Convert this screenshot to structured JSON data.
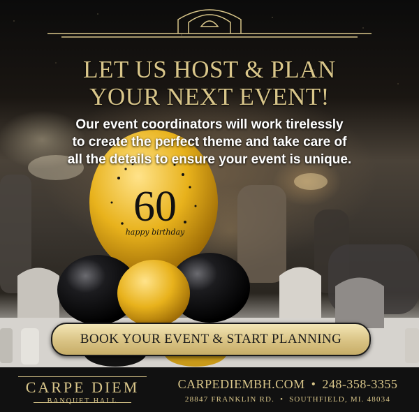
{
  "headline": {
    "line1": "LET US HOST & PLAN",
    "line2": "YOUR NEXT EVENT!"
  },
  "subheadline": {
    "line1": "Our event coordinators will work tirelessly",
    "line2": "to create the perfect theme and take care of",
    "line3": "all the details to ensure your event is unique."
  },
  "balloon": {
    "number": "60",
    "caption": "happy birthday"
  },
  "cta": {
    "label": "BOOK YOUR EVENT & START PLANNING"
  },
  "footer": {
    "logo_main": "CARPE DIEM",
    "logo_sub": "BANQUET HALL",
    "website": "CARPEDIEMBH.COM",
    "phone": "248-358-3355",
    "address": "28847 FRANKLIN RD.",
    "city": "SOUTHFIELD, MI. 48034",
    "separator": "•"
  },
  "colors": {
    "gold": "#d9c68a",
    "balloon_gold": "#e8b21c",
    "balloon_black": "#0d0d0d",
    "footer_bg": "#111111"
  }
}
